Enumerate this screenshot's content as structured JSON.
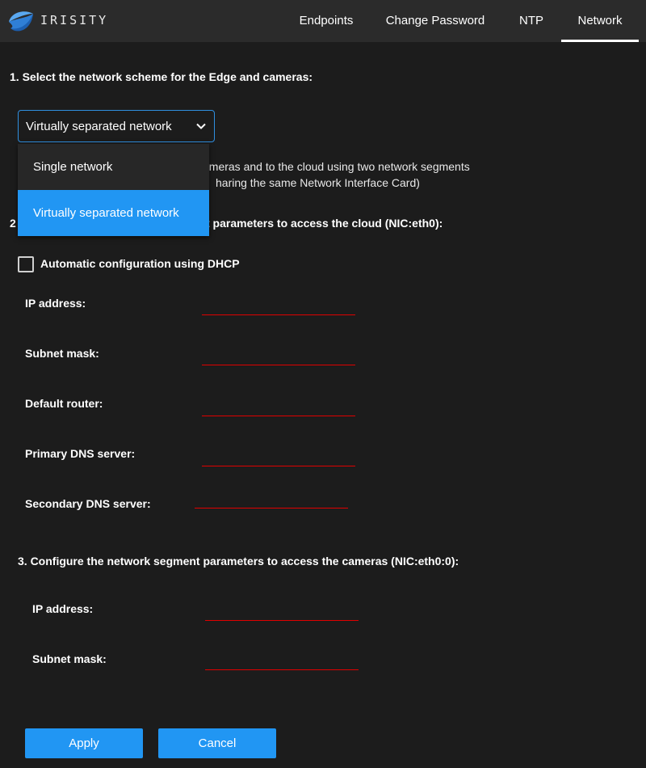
{
  "header": {
    "logo_text": "IRISITY",
    "tabs": [
      {
        "label": "Endpoints"
      },
      {
        "label": "Change Password"
      },
      {
        "label": "NTP"
      },
      {
        "label": "Network"
      }
    ]
  },
  "section1": {
    "heading": "1. Select the network scheme for the Edge and cameras:",
    "select_value": "Virtually separated network",
    "options": [
      "Single network",
      "Virtually separated network"
    ],
    "description_line1": "cameras and to the cloud using two network segments",
    "description_line2": "haring the same Network Interface Card)"
  },
  "section2": {
    "heading_prefix": "2",
    "heading_visible": "t parameters to access the cloud (NIC:eth0):",
    "dhcp_label": "Automatic configuration using DHCP",
    "dhcp_checked": false,
    "fields": [
      {
        "label": "IP address:",
        "value": ""
      },
      {
        "label": "Subnet mask:",
        "value": ""
      },
      {
        "label": "Default router:",
        "value": ""
      },
      {
        "label": "Primary DNS server:",
        "value": ""
      },
      {
        "label": "Secondary DNS server:",
        "value": ""
      }
    ]
  },
  "section3": {
    "heading": "3. Configure the network segment parameters to access the cameras (NIC:eth0:0):",
    "fields": [
      {
        "label": "IP address:",
        "value": ""
      },
      {
        "label": "Subnet mask:",
        "value": ""
      }
    ]
  },
  "buttons": {
    "apply": "Apply",
    "cancel": "Cancel"
  },
  "colors": {
    "accent": "#2196f3",
    "error_underline": "#e00000",
    "background": "#1c1c1c",
    "topbar": "#2b2b2b"
  }
}
